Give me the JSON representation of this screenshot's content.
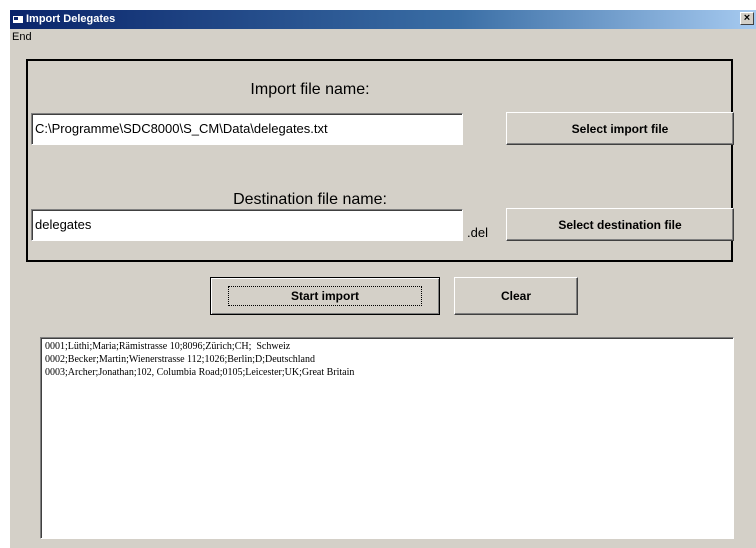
{
  "window": {
    "title": "Import Delegates",
    "close_glyph": "×"
  },
  "menu": {
    "items": [
      "End"
    ]
  },
  "import": {
    "label": "Import file name:",
    "value": "C:\\Programme\\SDC8000\\S_CM\\Data\\delegates.txt",
    "button": "Select import file"
  },
  "destination": {
    "label": "Destination file name:",
    "value": "delegates",
    "extension": ".del",
    "button": "Select destination file"
  },
  "actions": {
    "start": "Start import",
    "clear": "Clear"
  },
  "log": {
    "lines": [
      "0001;Lüthi;Maria;Rämistrasse 10;8096;Zürich;CH;  Schweiz",
      "0002;Becker;Martin;Wienerstrasse 112;1026;Berlin;D;Deutschland",
      "0003;Archer;Jonathan;102, Columbia Road;0105;Leicester;UK;Great Britain"
    ]
  }
}
